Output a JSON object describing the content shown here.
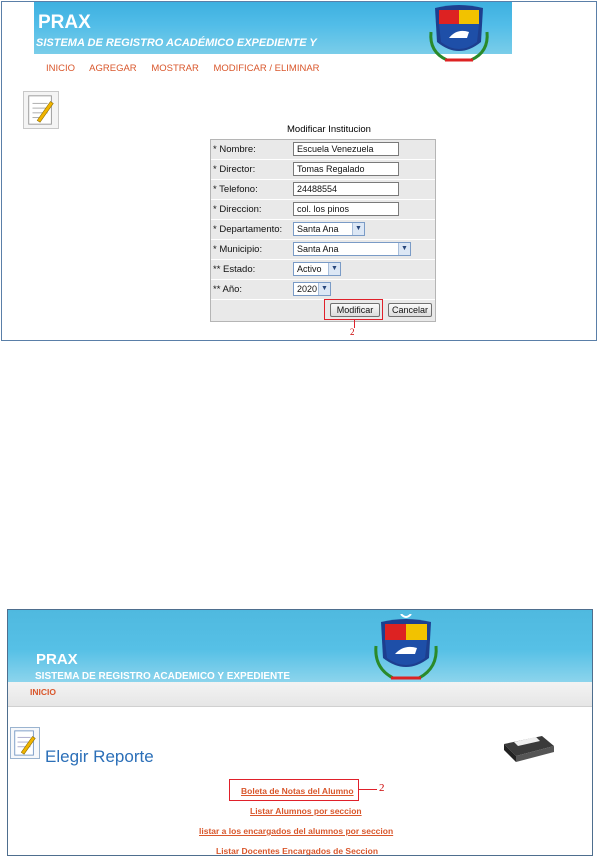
{
  "screenshot1": {
    "app_title": "PRAX",
    "app_subtitle": "SISTEMA DE REGISTRO ACADÉMICO EXPEDIENTE Y",
    "nav": [
      "INICIO",
      "AGREGAR",
      "MOSTRAR",
      "MODIFICAR / ELIMINAR"
    ],
    "form_title": "Modificar Institucion",
    "fields": [
      {
        "label": "* Nombre:",
        "value": "Escuela Venezuela",
        "type": "text"
      },
      {
        "label": "* Director:",
        "value": "Tomas Regalado",
        "type": "text"
      },
      {
        "label": "* Telefono:",
        "value": "24488554",
        "type": "text"
      },
      {
        "label": "* Direccion:",
        "value": "col. los pinos",
        "type": "text"
      },
      {
        "label": "* Departamento:",
        "value": "Santa Ana",
        "type": "select"
      },
      {
        "label": "* Municipio:",
        "value": "Santa Ana",
        "type": "select"
      },
      {
        "label": "** Estado:",
        "value": "Activo",
        "type": "select"
      },
      {
        "label": "** Año:",
        "value": "2020",
        "type": "select"
      }
    ],
    "buttons": {
      "modify": "Modificar",
      "cancel": "Cancelar"
    },
    "marker": "2"
  },
  "screenshot2": {
    "app_title": "PRAX",
    "app_subtitle": "SISTEMA DE REGISTRO ACADEMICO Y EXPEDIENTE",
    "nav": [
      "INICIO"
    ],
    "page_title": "Elegir Reporte",
    "links": [
      "Boleta de Notas del Alumno",
      "Listar Alumnos por seccion",
      "listar a los encargados del alumnos por seccion",
      "Listar Docentes Encargados de Seccion"
    ],
    "marker": "2"
  },
  "colors": {
    "banner": "#4fb9df",
    "nav_link": "#d9572c",
    "highlight": "#e0202a",
    "report_title": "#2b6fb8"
  }
}
